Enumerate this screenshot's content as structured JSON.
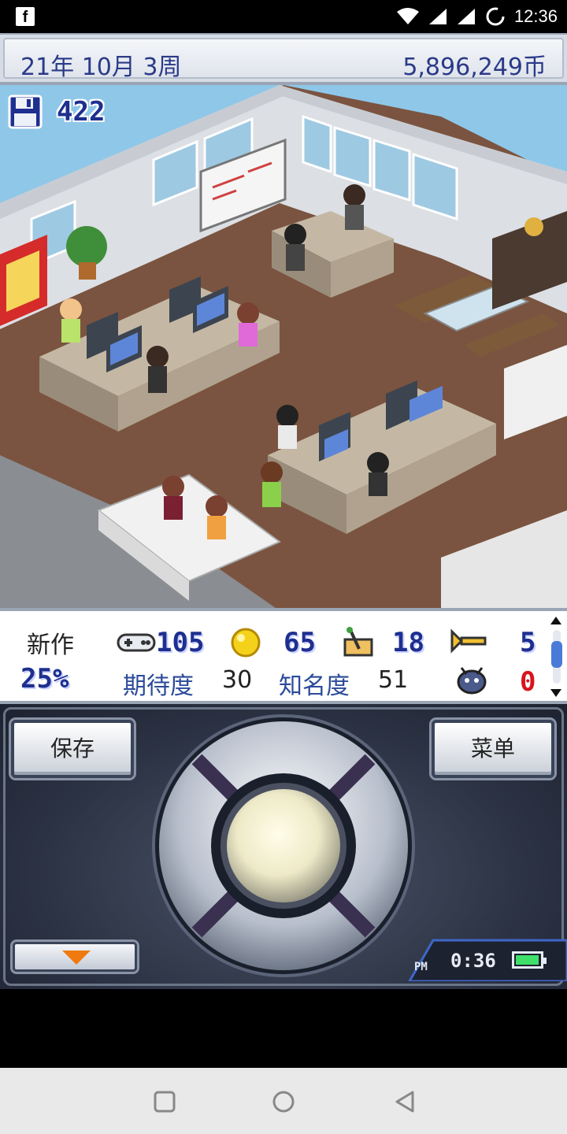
{
  "status_bar": {
    "app_icon": "facebook-icon",
    "time": "12:36",
    "icons": [
      "wifi-icon",
      "signal-icon",
      "loading-icon"
    ]
  },
  "header": {
    "date": "21年 10月 3周",
    "money": "5,896,249币"
  },
  "scene": {
    "save_count": "422"
  },
  "stats": {
    "new_title_label": "新作",
    "progress": "25%",
    "fun": "105",
    "creativity": "65",
    "graphics": "18",
    "sound": "5",
    "bugs": "0",
    "expectation_label": "期待度",
    "expectation_value": "30",
    "fame_label": "知名度",
    "fame_value": "51"
  },
  "controls": {
    "save_label": "保存",
    "menu_label": "菜单",
    "ampm": "PM",
    "game_time": "0:36",
    "battery_level": 0.85
  },
  "colors": {
    "accent_blue": "#1e2f8f",
    "bug_red": "#d8141e",
    "battery_green": "#3fe06a"
  }
}
